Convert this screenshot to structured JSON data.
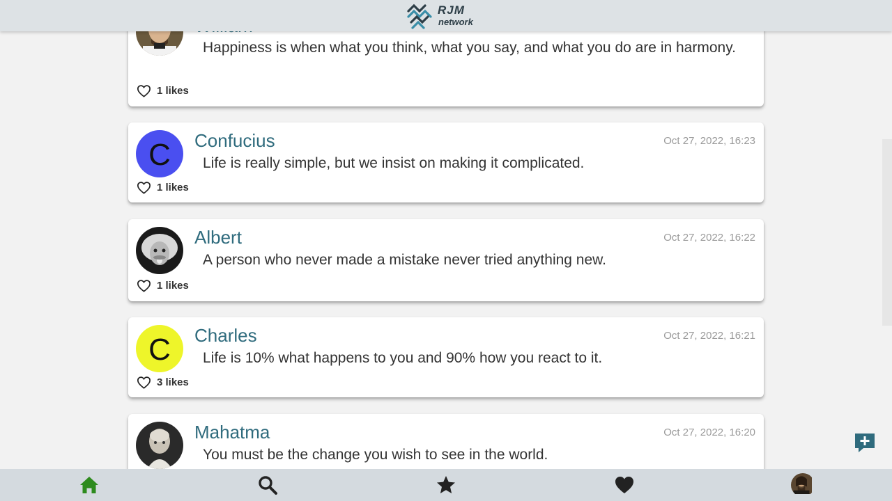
{
  "app": {
    "logo_line1": "RJM",
    "logo_line2": "network",
    "accent_color": "#2f6b7d",
    "home_active_color": "#2e8b1e"
  },
  "posts": [
    {
      "author": "William",
      "text": "Happiness is when what you think, what you say, and what you do are in harmony.",
      "likes_label": "1 likes",
      "avatar": "photo"
    },
    {
      "author": "Confucius",
      "date": "Oct 27, 2022, 16:23",
      "text": "Life is really simple, but we insist on making it complicated.",
      "likes_label": "1 likes",
      "avatar_letter": "C",
      "avatar_color": "#4a4ff0"
    },
    {
      "author": "Albert",
      "date": "Oct 27, 2022, 16:22",
      "text": "A person who never made a mistake never tried anything new.",
      "likes_label": "1 likes",
      "avatar": "photo"
    },
    {
      "author": "Charles",
      "date": "Oct 27, 2022, 16:21",
      "text": "Life is 10% what happens to you and 90% how you react to it.",
      "likes_label": "3 likes",
      "avatar_letter": "C",
      "avatar_color": "#eef52a"
    },
    {
      "author": "Mahatma",
      "date": "Oct 27, 2022, 16:20",
      "text": "You must be the change you wish to see in the world.",
      "avatar": "photo"
    }
  ],
  "nav": {
    "items": [
      {
        "icon": "home-icon",
        "active": true
      },
      {
        "icon": "search-icon"
      },
      {
        "icon": "star-icon"
      },
      {
        "icon": "heart-icon"
      },
      {
        "icon": "profile-avatar"
      }
    ]
  },
  "fab": {
    "icon": "add-comment-icon"
  }
}
